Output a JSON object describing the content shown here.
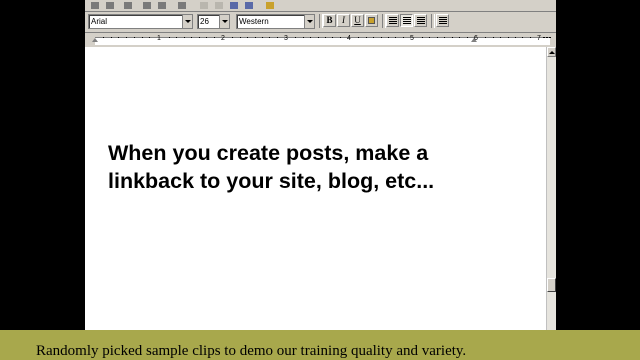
{
  "toolbar": {
    "font_name": "Arial",
    "font_size": "26",
    "script": "Western",
    "bold_label": "B",
    "italic_label": "I",
    "underline_label": "U"
  },
  "ruler": {
    "numbers": [
      "1",
      "2",
      "3",
      "4",
      "5",
      "6",
      "7"
    ]
  },
  "document": {
    "line1": "When you create posts, make a",
    "line2": "linkback to your site, blog, etc..."
  },
  "caption": {
    "text": "Randomly picked sample clips to demo our training quality and variety."
  },
  "colors": {
    "chrome": "#d4d0c8",
    "caption_bg": "#a8a84c",
    "background": "#000000"
  }
}
